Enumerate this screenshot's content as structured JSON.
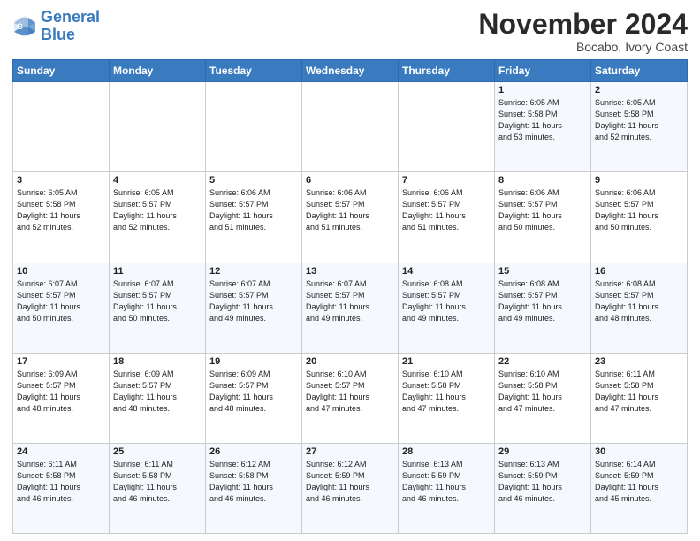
{
  "logo": {
    "line1": "General",
    "line2": "Blue"
  },
  "header": {
    "month": "November 2024",
    "location": "Bocabo, Ivory Coast"
  },
  "days_of_week": [
    "Sunday",
    "Monday",
    "Tuesday",
    "Wednesday",
    "Thursday",
    "Friday",
    "Saturday"
  ],
  "weeks": [
    [
      {
        "day": "",
        "info": ""
      },
      {
        "day": "",
        "info": ""
      },
      {
        "day": "",
        "info": ""
      },
      {
        "day": "",
        "info": ""
      },
      {
        "day": "",
        "info": ""
      },
      {
        "day": "1",
        "info": "Sunrise: 6:05 AM\nSunset: 5:58 PM\nDaylight: 11 hours\nand 53 minutes."
      },
      {
        "day": "2",
        "info": "Sunrise: 6:05 AM\nSunset: 5:58 PM\nDaylight: 11 hours\nand 52 minutes."
      }
    ],
    [
      {
        "day": "3",
        "info": "Sunrise: 6:05 AM\nSunset: 5:58 PM\nDaylight: 11 hours\nand 52 minutes."
      },
      {
        "day": "4",
        "info": "Sunrise: 6:05 AM\nSunset: 5:57 PM\nDaylight: 11 hours\nand 52 minutes."
      },
      {
        "day": "5",
        "info": "Sunrise: 6:06 AM\nSunset: 5:57 PM\nDaylight: 11 hours\nand 51 minutes."
      },
      {
        "day": "6",
        "info": "Sunrise: 6:06 AM\nSunset: 5:57 PM\nDaylight: 11 hours\nand 51 minutes."
      },
      {
        "day": "7",
        "info": "Sunrise: 6:06 AM\nSunset: 5:57 PM\nDaylight: 11 hours\nand 51 minutes."
      },
      {
        "day": "8",
        "info": "Sunrise: 6:06 AM\nSunset: 5:57 PM\nDaylight: 11 hours\nand 50 minutes."
      },
      {
        "day": "9",
        "info": "Sunrise: 6:06 AM\nSunset: 5:57 PM\nDaylight: 11 hours\nand 50 minutes."
      }
    ],
    [
      {
        "day": "10",
        "info": "Sunrise: 6:07 AM\nSunset: 5:57 PM\nDaylight: 11 hours\nand 50 minutes."
      },
      {
        "day": "11",
        "info": "Sunrise: 6:07 AM\nSunset: 5:57 PM\nDaylight: 11 hours\nand 50 minutes."
      },
      {
        "day": "12",
        "info": "Sunrise: 6:07 AM\nSunset: 5:57 PM\nDaylight: 11 hours\nand 49 minutes."
      },
      {
        "day": "13",
        "info": "Sunrise: 6:07 AM\nSunset: 5:57 PM\nDaylight: 11 hours\nand 49 minutes."
      },
      {
        "day": "14",
        "info": "Sunrise: 6:08 AM\nSunset: 5:57 PM\nDaylight: 11 hours\nand 49 minutes."
      },
      {
        "day": "15",
        "info": "Sunrise: 6:08 AM\nSunset: 5:57 PM\nDaylight: 11 hours\nand 49 minutes."
      },
      {
        "day": "16",
        "info": "Sunrise: 6:08 AM\nSunset: 5:57 PM\nDaylight: 11 hours\nand 48 minutes."
      }
    ],
    [
      {
        "day": "17",
        "info": "Sunrise: 6:09 AM\nSunset: 5:57 PM\nDaylight: 11 hours\nand 48 minutes."
      },
      {
        "day": "18",
        "info": "Sunrise: 6:09 AM\nSunset: 5:57 PM\nDaylight: 11 hours\nand 48 minutes."
      },
      {
        "day": "19",
        "info": "Sunrise: 6:09 AM\nSunset: 5:57 PM\nDaylight: 11 hours\nand 48 minutes."
      },
      {
        "day": "20",
        "info": "Sunrise: 6:10 AM\nSunset: 5:57 PM\nDaylight: 11 hours\nand 47 minutes."
      },
      {
        "day": "21",
        "info": "Sunrise: 6:10 AM\nSunset: 5:58 PM\nDaylight: 11 hours\nand 47 minutes."
      },
      {
        "day": "22",
        "info": "Sunrise: 6:10 AM\nSunset: 5:58 PM\nDaylight: 11 hours\nand 47 minutes."
      },
      {
        "day": "23",
        "info": "Sunrise: 6:11 AM\nSunset: 5:58 PM\nDaylight: 11 hours\nand 47 minutes."
      }
    ],
    [
      {
        "day": "24",
        "info": "Sunrise: 6:11 AM\nSunset: 5:58 PM\nDaylight: 11 hours\nand 46 minutes."
      },
      {
        "day": "25",
        "info": "Sunrise: 6:11 AM\nSunset: 5:58 PM\nDaylight: 11 hours\nand 46 minutes."
      },
      {
        "day": "26",
        "info": "Sunrise: 6:12 AM\nSunset: 5:58 PM\nDaylight: 11 hours\nand 46 minutes."
      },
      {
        "day": "27",
        "info": "Sunrise: 6:12 AM\nSunset: 5:59 PM\nDaylight: 11 hours\nand 46 minutes."
      },
      {
        "day": "28",
        "info": "Sunrise: 6:13 AM\nSunset: 5:59 PM\nDaylight: 11 hours\nand 46 minutes."
      },
      {
        "day": "29",
        "info": "Sunrise: 6:13 AM\nSunset: 5:59 PM\nDaylight: 11 hours\nand 46 minutes."
      },
      {
        "day": "30",
        "info": "Sunrise: 6:14 AM\nSunset: 5:59 PM\nDaylight: 11 hours\nand 45 minutes."
      }
    ]
  ]
}
